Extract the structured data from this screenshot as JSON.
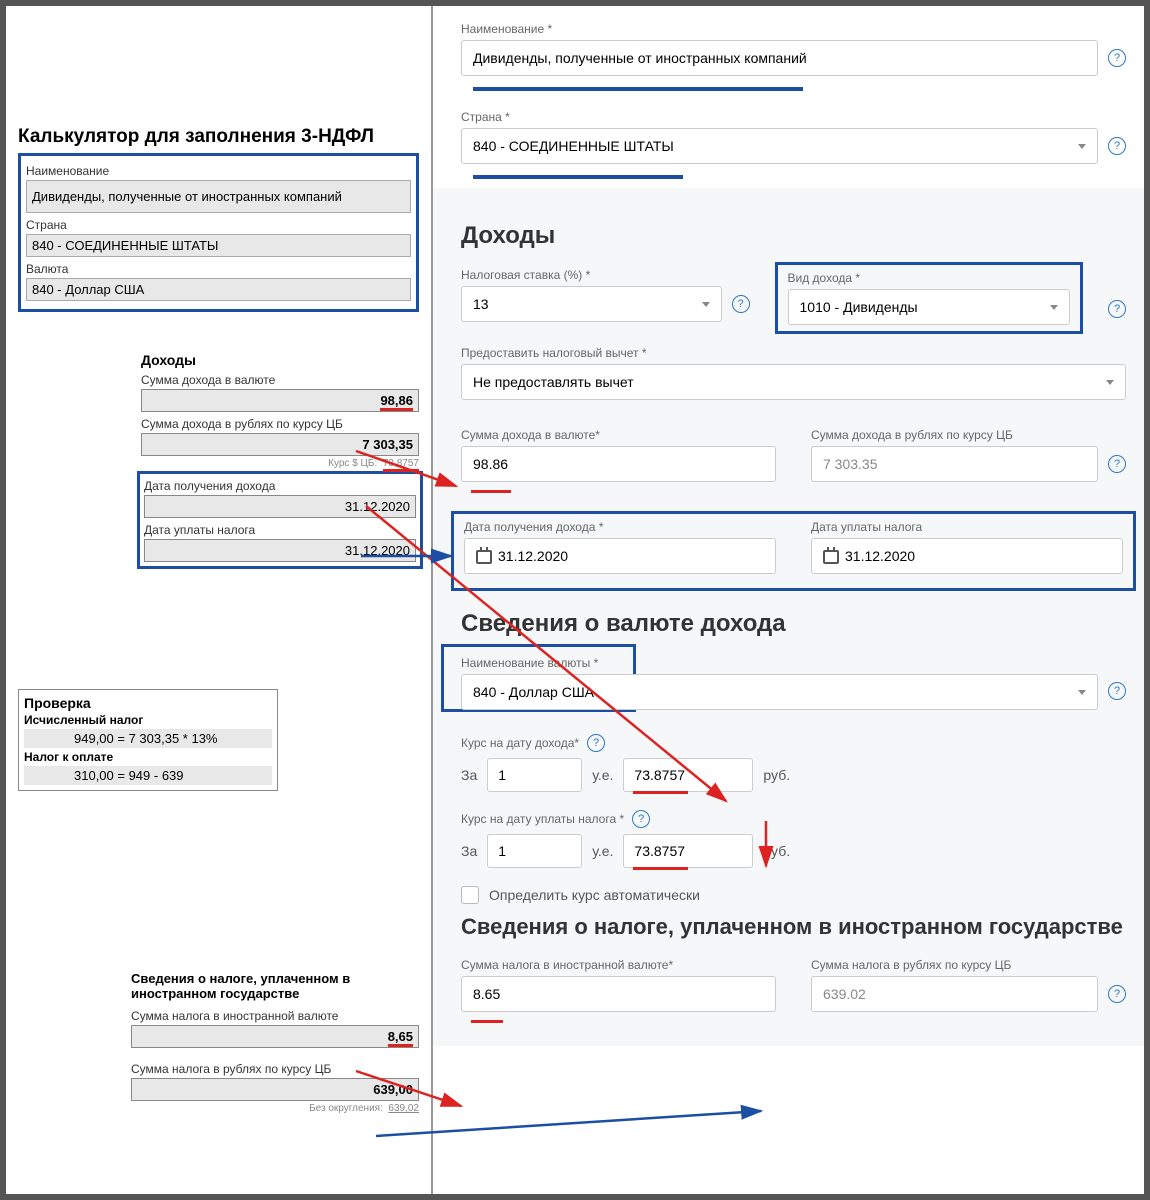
{
  "left": {
    "calc_title": "Калькулятор для заполнения 3-НДФЛ",
    "name_label": "Наименование",
    "name_value": "Дивиденды, полученные от иностранных компаний",
    "country_label": "Страна",
    "country_value": "840 - СОЕДИНЕННЫЕ ШТАТЫ",
    "currency_label": "Валюта",
    "currency_value": "840 - Доллар США",
    "income_title": "Доходы",
    "income_fx_label": "Сумма дохода в валюте",
    "income_fx_value": "98,86",
    "income_rub_label": "Сумма дохода в рублях по курсу ЦБ",
    "income_rub_value": "7 303,35",
    "rate_cb_label": "Курс $ ЦБ:",
    "rate_cb_value": "73,8757",
    "date_income_label": "Дата получения дохода",
    "date_income_value": "31.12.2020",
    "date_tax_label": "Дата уплаты налога",
    "date_tax_value": "31.12.2020",
    "check_title": "Проверка",
    "calc_tax_label": "Исчисленный налог",
    "calc_tax_value": "949,00  =  7 303,35 * 13%",
    "tax_due_label": "Налог к оплате",
    "tax_due_value": "310,00  =  949 - 639",
    "foreign_tax_title": "Сведения о налоге, уплаченном в иностранном государстве",
    "ftax_fx_label": "Сумма налога в иностранной валюте",
    "ftax_fx_value": "8,65",
    "ftax_rub_label": "Сумма налога в рублях по курсу ЦБ",
    "ftax_rub_value": "639,00",
    "ftax_noround_label": "Без округления:",
    "ftax_noround_value": "639,02"
  },
  "right": {
    "name_label": "Наименование *",
    "name_value": "Дивиденды, полученные от иностранных компаний",
    "country_label": "Страна *",
    "country_value": "840 - СОЕДИНЕННЫЕ ШТАТЫ",
    "income_title": "Доходы",
    "tax_rate_label": "Налоговая ставка (%) *",
    "tax_rate_value": "13",
    "income_type_label": "Вид дохода *",
    "income_type_value": "1010 - Дивиденды",
    "deduction_label": "Предоставить налоговый вычет *",
    "deduction_value": "Не предоставлять вычет",
    "income_fx_label": "Сумма дохода в валюте*",
    "income_fx_value": "98.86",
    "income_rub_label": "Сумма дохода в рублях по курсу ЦБ",
    "income_rub_value": "7 303.35",
    "date_income_label": "Дата получения дохода *",
    "date_income_value": "31.12.2020",
    "date_tax_label": "Дата уплаты налога",
    "date_tax_value": "31.12.2020",
    "currency_title": "Сведения о валюте дохода",
    "currency_name_label": "Наименование валюты *",
    "currency_name_value": "840 - Доллар США",
    "rate_income_label": "Курс на дату дохода*",
    "rate_tax_label": "Курс на дату уплаты налога *",
    "za": "За",
    "one": "1",
    "ue": "у.е.",
    "rate_value": "73.8757",
    "rub": "руб.",
    "auto_rate_label": "Определить курс автоматически",
    "foreign_tax_title": "Сведения о налоге, уплаченном в иностранном государстве",
    "ftax_fx_label": "Сумма налога в иностранной валюте*",
    "ftax_fx_value": "8.65",
    "ftax_rub_label": "Сумма налога в рублях по курсу ЦБ",
    "ftax_rub_value": "639.02"
  }
}
